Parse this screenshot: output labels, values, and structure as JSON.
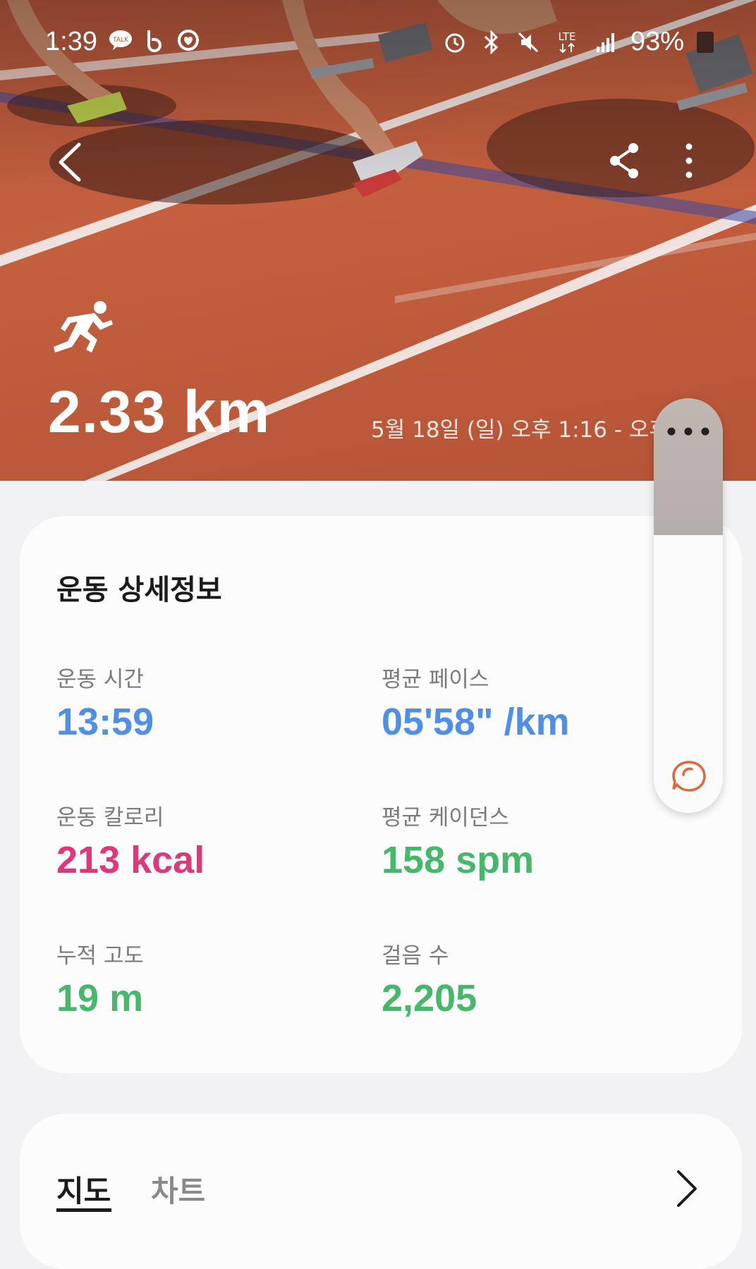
{
  "status_bar": {
    "time": "1:39",
    "left_icons": [
      "kakaotalk-icon",
      "band-icon",
      "health-ring-icon"
    ],
    "right_icons": [
      "alarm-icon",
      "bluetooth-icon",
      "mute-icon",
      "lte-icon",
      "signal-icon"
    ],
    "lte_label": "LTE",
    "battery": "93%"
  },
  "header": {
    "activity_icon": "running-icon",
    "distance": "2.33 km",
    "date_range": "5월 18일 (일) 오후 1:16 - 오후"
  },
  "details_card": {
    "title": "운동 상세정보",
    "metrics": [
      {
        "label": "운동 시간",
        "value": "13:59",
        "color": "#4f8fe6"
      },
      {
        "label": "평균 페이스",
        "value": "05'58\" /km",
        "color": "#4f8fe6"
      },
      {
        "label": "운동 칼로리",
        "value": "213 kcal",
        "color": "#e0367a"
      },
      {
        "label": "평균 케이던스",
        "value": "158 spm",
        "color": "#45b86a"
      },
      {
        "label": "누적 고도",
        "value": "19 m",
        "color": "#45b86a"
      },
      {
        "label": "걸음 수",
        "value": "2,205",
        "color": "#45b86a"
      }
    ]
  },
  "map_card": {
    "tabs": [
      {
        "label": "지도",
        "selected": true
      },
      {
        "label": "차트",
        "selected": false
      }
    ]
  },
  "colors": {
    "track": "#c05d3f",
    "accent_blue": "#4f8fe6",
    "accent_pink": "#e0367a",
    "accent_green": "#45b86a"
  }
}
